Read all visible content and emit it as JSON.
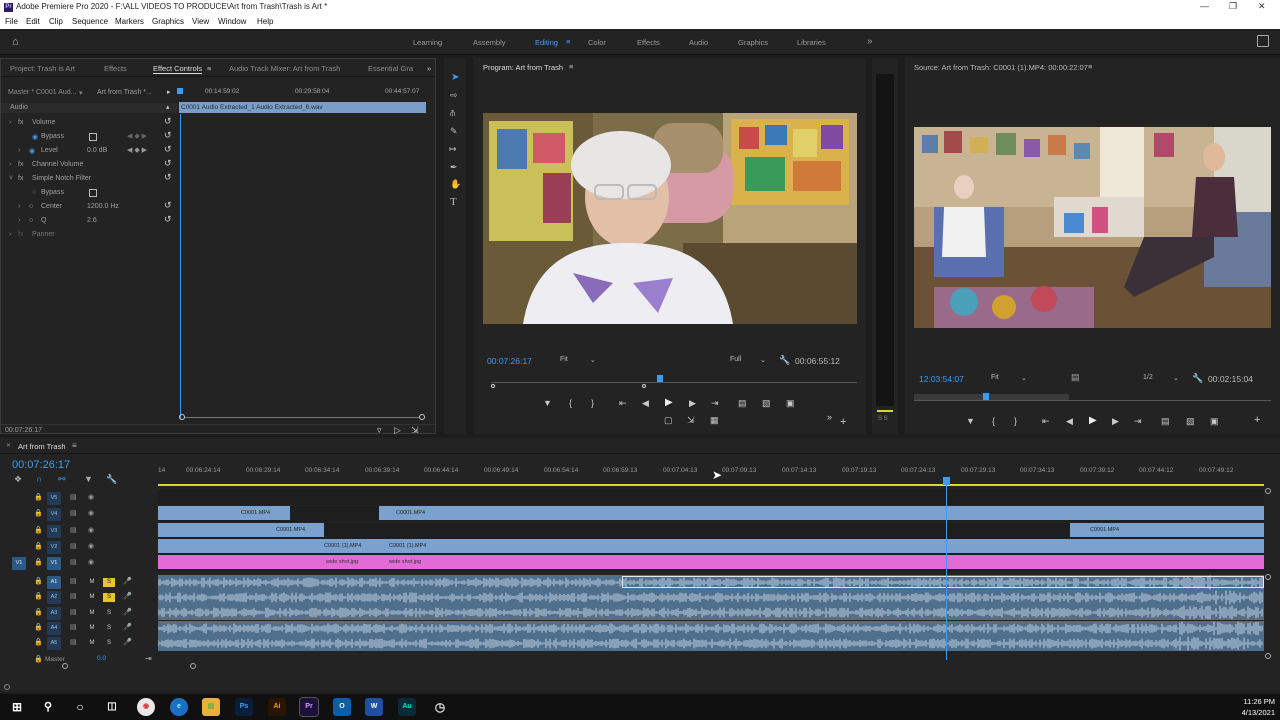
{
  "window": {
    "title": "Adobe Premiere Pro 2020 - F:\\ALL VIDEOS TO PRODUCE\\Art from Trash\\Trash is Art *",
    "app_icon": "Pr"
  },
  "menu": [
    "File",
    "Edit",
    "Clip",
    "Sequence",
    "Markers",
    "Graphics",
    "View",
    "Window",
    "Help"
  ],
  "workspaces": [
    "Learning",
    "Assembly",
    "Editing",
    "Color",
    "Effects",
    "Audio",
    "Graphics",
    "Libraries"
  ],
  "active_workspace": "Editing",
  "left_panel": {
    "tabs": [
      "Project: Trash is Art",
      "Effects",
      "Effect Controls",
      "Audio Track Mixer: Art from Trash",
      "Essential Gra"
    ],
    "active_tab": "Effect Controls",
    "master": "Master * C0001 Aud...",
    "sequence": "Art from Trash *...",
    "ruler": [
      "00:14:59:02",
      "00:29:58:04",
      "00:44:57:07"
    ],
    "clip_name": "C0001 Audio Extracted_1 Audio Extracted_6.wav",
    "section": "Audio",
    "rows": [
      {
        "label": "Volume",
        "type": "fx"
      },
      {
        "label": "Bypass",
        "type": "check"
      },
      {
        "label": "Level",
        "value": "0.0 dB"
      },
      {
        "label": "Channel Volume",
        "type": "fx"
      },
      {
        "label": "Simple Notch Filter",
        "type": "fx"
      },
      {
        "label": "Bypass",
        "type": "check"
      },
      {
        "label": "Center",
        "value": "1200.0 Hz"
      },
      {
        "label": "Q",
        "value": "2.6"
      },
      {
        "label": "Panner",
        "type": "fx"
      }
    ],
    "timecode": "00:07:26:17"
  },
  "program": {
    "title": "Program: Art from Trash",
    "timecode": "00:07:26:17",
    "fit": "Fit",
    "quality": "Full",
    "duration": "00:06:55:12"
  },
  "source": {
    "title": "Source: Art from Trash: C0001 (1).MP4: 00:00:22:07",
    "timecode": "12:03:54:07",
    "fit": "Fit",
    "quality": "1/2",
    "duration": "00:02:15:04"
  },
  "timeline": {
    "tab": "Art from Trash",
    "timecode": "00:07:26:17",
    "ruler": [
      "14",
      "00:06:24:14",
      "00:06:29:14",
      "00:06:34:14",
      "00:06:39:14",
      "00:06:44:14",
      "00:06:49:14",
      "00:06:54:14",
      "00:06:59:13",
      "00:07:04:13",
      "00:07:09:13",
      "00:07:14:13",
      "00:07:19:13",
      "00:07:24:13",
      "00:07:29:13",
      "00:07:34:13",
      "00:07:39:12",
      "00:07:44:12",
      "00:07:49:12"
    ],
    "video_tracks": [
      "V5",
      "V4",
      "V3",
      "V2",
      "V1"
    ],
    "audio_tracks": [
      "A1",
      "A2",
      "A3",
      "A4",
      "A5"
    ],
    "master": "Master",
    "master_value": "0.0",
    "clips": {
      "v4a": "C0001.MP4",
      "v4b": "C0001.MP4",
      "v3a": "C0001.MP4",
      "v3b": "C0001.MP4",
      "v2a": "C0001 (1).MP4",
      "v2b": "C0001 (1).MP4",
      "v1a": "wide shot.jpg",
      "v1b": "wide shot.jpg"
    }
  },
  "taskbar": {
    "time": "11:26 PM",
    "date": "4/13/2021",
    "apps": [
      "Ps",
      "Ai",
      "Pr",
      "W",
      "Au"
    ]
  }
}
